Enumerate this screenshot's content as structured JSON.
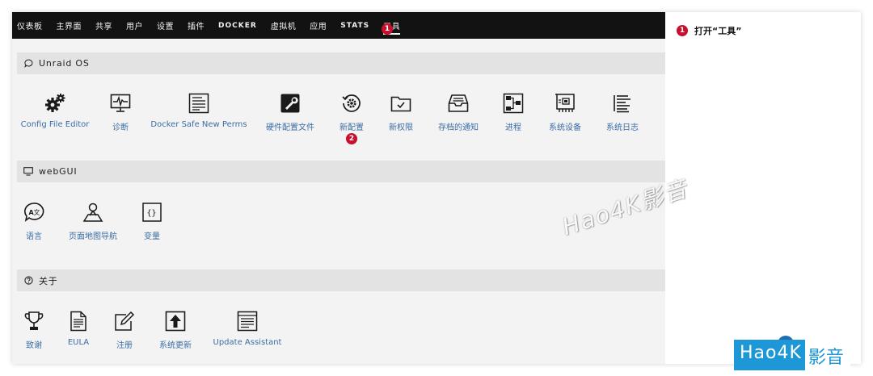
{
  "navbar": {
    "items": [
      {
        "label": "仪表板"
      },
      {
        "label": "主界面"
      },
      {
        "label": "共享"
      },
      {
        "label": "用户"
      },
      {
        "label": "设置"
      },
      {
        "label": "插件"
      },
      {
        "label": "DOCKER"
      },
      {
        "label": "虚拟机"
      },
      {
        "label": "应用"
      },
      {
        "label": "STATS"
      },
      {
        "label": "工具",
        "active": true
      }
    ],
    "step_badge": "1"
  },
  "sections": [
    {
      "title": "Unraid OS",
      "icon": "chat-bubble-icon",
      "tools": [
        {
          "label": "Config File Editor",
          "icon": "gears-icon"
        },
        {
          "label": "诊断",
          "icon": "heartbeat-monitor-icon"
        },
        {
          "label": "Docker Safe New Perms",
          "icon": "document-icon"
        },
        {
          "label": "硬件配置文件",
          "icon": "wrench-icon"
        },
        {
          "label": "新配置",
          "icon": "reset-gear-icon",
          "step_badge": "2"
        },
        {
          "label": "新权限",
          "icon": "folder-check-icon"
        },
        {
          "label": "存档的通知",
          "icon": "inbox-tray-icon"
        },
        {
          "label": "进程",
          "icon": "process-tree-icon"
        },
        {
          "label": "系统设备",
          "icon": "circuit-board-icon"
        },
        {
          "label": "系统日志",
          "icon": "list-lines-icon"
        }
      ]
    },
    {
      "title": "webGUI",
      "icon": "monitor-icon",
      "tools": [
        {
          "label": "语言",
          "icon": "translate-bubble-icon"
        },
        {
          "label": "页面地图导航",
          "icon": "map-person-icon"
        },
        {
          "label": "变量",
          "icon": "braces-icon"
        }
      ]
    },
    {
      "title": "关于",
      "icon": "question-circle-icon",
      "tools": [
        {
          "label": "致谢",
          "icon": "trophy-icon"
        },
        {
          "label": "EULA",
          "icon": "document-lines-icon"
        },
        {
          "label": "注册",
          "icon": "edit-pen-icon"
        },
        {
          "label": "系统更新",
          "icon": "upload-box-icon"
        },
        {
          "label": "Update Assistant",
          "icon": "window-lines-icon"
        }
      ]
    }
  ],
  "sidebar": {
    "step_badge": "1",
    "note": "打开“工具”"
  },
  "watermark": "Hao4K影音",
  "logo": {
    "part1": "Hao4K",
    "part2": "影音"
  },
  "colors": {
    "navbar": "#121212",
    "accent_badge": "#c8102e",
    "link": "#3b6ea5",
    "logo_blue": "#1d97d6"
  }
}
